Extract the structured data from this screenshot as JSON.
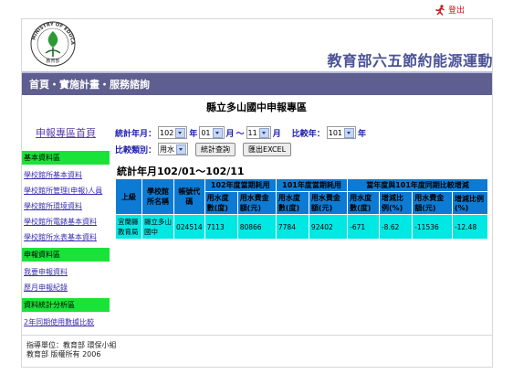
{
  "header": {
    "logout_label": "登出",
    "site_title": "教育部六五節約能源運動",
    "logo_text": "MINISTRY OF EDUCATION"
  },
  "nav": {
    "home": "首頁",
    "plan": "實施計畫",
    "consult": "服務諮詢",
    "separator": "・"
  },
  "page_heading": "縣立多山國中申報專區",
  "sidebar": {
    "home_link": "申報專區首頁",
    "sections": [
      {
        "title": "基本資料區",
        "links": [
          "學校館所基本資料",
          "學校館所管理(申報)人員",
          "學校館所環境資料",
          "學校館所電錶基本資料",
          "學校館所水表基本資料"
        ]
      },
      {
        "title": "申報資料區",
        "links": [
          "我要申報資料",
          "歷月申報紀錄"
        ]
      },
      {
        "title": "資料統計分析區",
        "links": [
          "2年同期使用數據比較"
        ]
      }
    ]
  },
  "filters": {
    "stat_month_label": "統計年月：",
    "year_value": "102",
    "year_unit": "年",
    "month_from": "01",
    "month_unit": "月",
    "range_sep": "～",
    "month_to": "11",
    "compare_year_label": "比較年：",
    "compare_year_value": "101",
    "compare_type_label": "比較類別：",
    "compare_type_value": "用水",
    "query_button": "統計查詢",
    "export_button": "匯出EXCEL"
  },
  "stat_title": "統計年月102/01～102/11",
  "table": {
    "headers": {
      "parent": "上級",
      "school_name": "學校館所名稱",
      "account": "帳號代碼",
      "cur_group": "102年度當期耗用",
      "prev_group": "101年度當期耗用",
      "cmp_group": "當年度與101年度同期比較增減",
      "cur_water": "用水度數(度)",
      "cur_fee": "用水費金額(元)",
      "prev_water": "用水度數(度)",
      "prev_fee": "用水費金額(元)",
      "cmp_water": "用水度數(度)",
      "cmp_water_pct": "增減比例(%)",
      "cmp_fee": "用水費金額(元)",
      "cmp_fee_pct": "增減比例(%)"
    },
    "row": {
      "parent": "宜蘭縣教育局",
      "school_name": "縣立多山國中",
      "account": "024514",
      "cur_water": "7113",
      "cur_fee": "80866",
      "prev_water": "7784",
      "prev_fee": "92402",
      "cmp_water": "-671",
      "cmp_water_pct": "-8.62",
      "cmp_fee": "-11536",
      "cmp_fee_pct": "-12.48"
    }
  },
  "footer": {
    "line1": "指導單位：教育部 環保小組",
    "line2": "教育部 版權所有 2006"
  },
  "colors": {
    "nav_bg": "#5e5e90",
    "title": "#4a5296",
    "table_header": "#0d7bd4",
    "table_cell": "#00e8e4",
    "section_bg": "#19e338"
  }
}
